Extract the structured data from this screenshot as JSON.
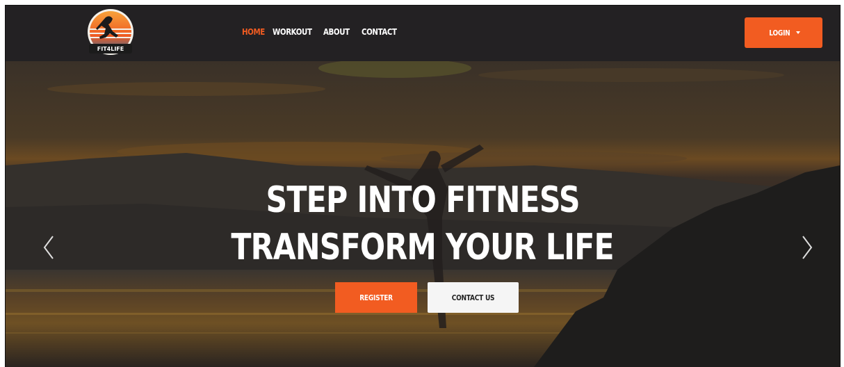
{
  "brand": {
    "logo_text": "FIT4LIFE",
    "accent": "#f25c21"
  },
  "nav": {
    "items": [
      {
        "label": "HOME",
        "active": true
      },
      {
        "label": "WORKOUT",
        "active": false
      },
      {
        "label": "ABOUT",
        "active": false
      },
      {
        "label": "CONTACT",
        "active": false
      }
    ],
    "login_label": "LOGIN"
  },
  "hero": {
    "title_line1": "STEP INTO FITNESS",
    "title_line2": "TRANSFORM YOUR LIFE",
    "register_label": "REGISTER",
    "contact_label": "CONTACT US",
    "prev_icon": "chevron-left-icon",
    "next_icon": "chevron-right-icon"
  }
}
